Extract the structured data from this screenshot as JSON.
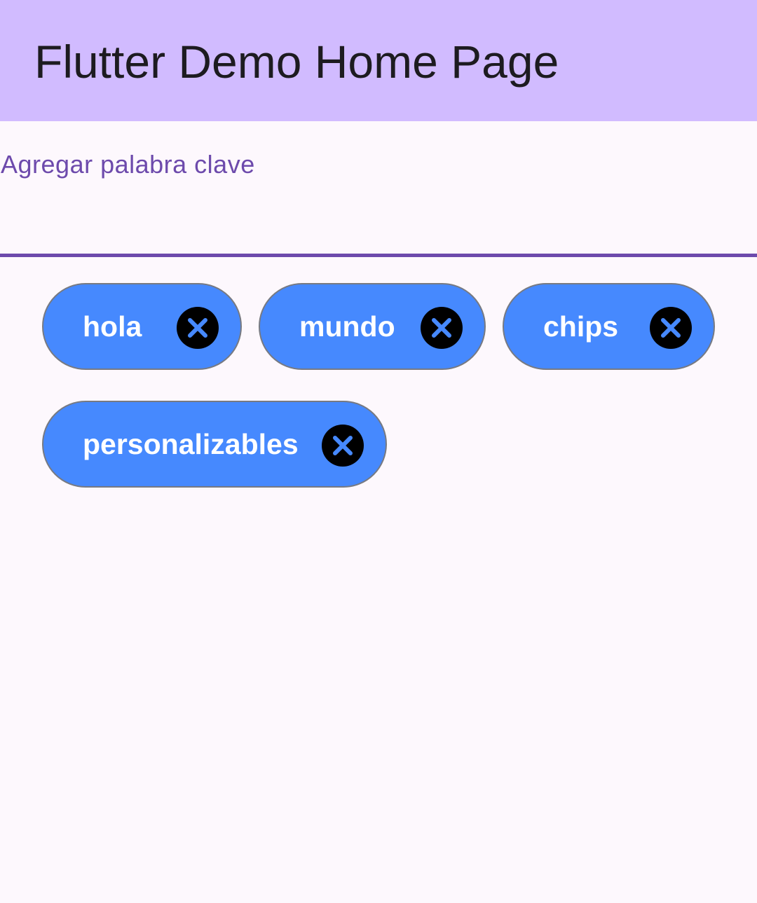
{
  "app_bar": {
    "title": "Flutter Demo Home Page"
  },
  "keyword_field": {
    "label": "Agregar palabra clave",
    "value": ""
  },
  "chips": [
    {
      "label": "hola",
      "delete_icon": "cancel-icon"
    },
    {
      "label": "mundo",
      "delete_icon": "cancel-icon"
    },
    {
      "label": "chips",
      "delete_icon": "cancel-icon"
    },
    {
      "label": "personalizables",
      "delete_icon": "cancel-icon"
    }
  ],
  "colors": {
    "app_bar_background": "#d1bbff",
    "page_background": "#fdf8fd",
    "accent": "#6d4aac",
    "chip_background": "#4689fe",
    "chip_border": "#777a82",
    "chip_text": "#ffffff",
    "delete_icon_background": "#000000",
    "delete_icon_cross": "#4689fe"
  }
}
